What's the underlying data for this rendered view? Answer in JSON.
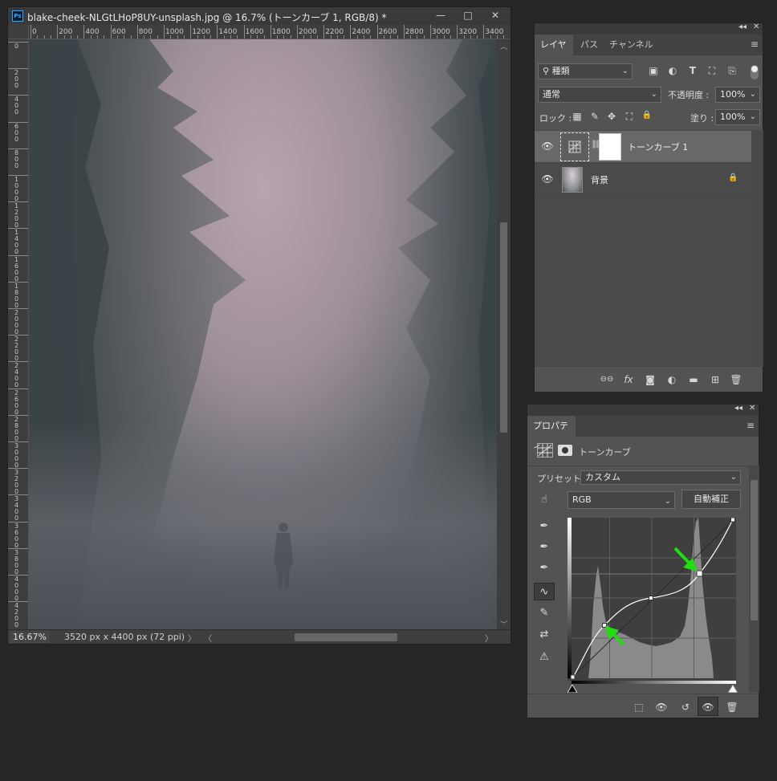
{
  "document": {
    "title": "blake-cheek-NLGtLHoP8UY-unsplash.jpg @ 16.7% (トーンカーブ 1, RGB/8) *",
    "ps_badge": "Ps",
    "controls": {
      "minimize": "—",
      "restore": "□",
      "close": "✕"
    },
    "ruler_h_labels": [
      "0",
      "200",
      "400",
      "600",
      "800",
      "1000",
      "1200",
      "1400",
      "1600",
      "1800",
      "2000",
      "2200",
      "2400",
      "2600",
      "2800",
      "3000",
      "3200",
      "3400"
    ],
    "ruler_v_labels": [
      "0",
      "2 0 0",
      "4 0 0",
      "6 0 0",
      "8 0 0",
      "1 0 0 0",
      "1 2 0 0",
      "1 4 0 0",
      "1 6 0 0",
      "1 8 0 0",
      "2 0 0 0",
      "2 2 0 0",
      "2 4 0 0",
      "2 6 0 0",
      "2 8 0 0",
      "3 0 0 0",
      "3 2 0 0",
      "3 4 0 0",
      "3 6 0 0",
      "3 8 0 0",
      "4 0 0 0",
      "4 2 0 0"
    ],
    "zoom": "16.67%",
    "doc_info": "3520 px x 4400 px (72 ppi)",
    "status_arrow": "〉",
    "scroll_left": "〈",
    "scroll_right": "〉",
    "scroll_up": "︿",
    "scroll_down": "﹀"
  },
  "layers_panel": {
    "collapse": "◂◂",
    "close": "✕",
    "tabs": [
      "レイヤー",
      "パス",
      "チャンネル"
    ],
    "menu": "≡",
    "filter_kind": "種類",
    "filter_search_icon": "⚲",
    "filter_icons": [
      "▣",
      "◐",
      "T",
      "⛶",
      "⎘"
    ],
    "blend_mode": "通常",
    "opacity_label": "不透明度 :",
    "opacity_value": "100%",
    "lock_label": "ロック :",
    "lock_icons": [
      "▦",
      "✎",
      "✥",
      "⛶",
      "🔒"
    ],
    "fill_label": "塗り :",
    "fill_value": "100%",
    "layers": [
      {
        "name": "トーンカーブ 1",
        "selected": true
      },
      {
        "name": "背景",
        "locked": true
      }
    ],
    "footer_icons": [
      "⊖⊖",
      "fx",
      "◙",
      "◐",
      "▬",
      "⊞",
      "🗑"
    ]
  },
  "properties_panel": {
    "collapse": "◂◂",
    "close": "✕",
    "tab": "プロパティ",
    "menu": "≡",
    "adjustment_title": "トーンカーブ",
    "preset_label": "プリセット :",
    "preset_value": "カスタム",
    "channel": "RGB",
    "auto_button": "自動補正",
    "footer_icons": [
      "⬚",
      "👁",
      "↺",
      "👁",
      "🗑"
    ]
  }
}
